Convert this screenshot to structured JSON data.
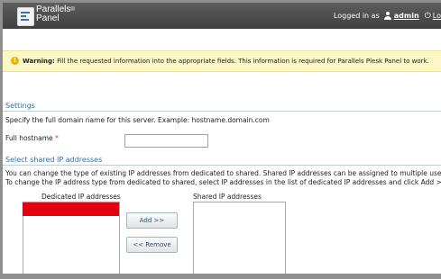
{
  "header": {
    "brand_line1": "Parallels",
    "brand_reg": "®",
    "brand_line2": "Panel",
    "logged_in_as": "Logged in as",
    "username": "admin",
    "logout_partial": "Lo"
  },
  "warning": {
    "label": "Warning:",
    "text": "Fill the requested information into the appropriate fields. This information is required for Parallels Plesk Panel to work."
  },
  "settings": {
    "title": "Settings",
    "description": "Specify the full domain name for this server. Example: hostname.domain.com",
    "hostname_label": "Full hostname",
    "required_mark": "*",
    "hostname_value": ""
  },
  "shared_ip": {
    "title": "Select shared IP addresses",
    "desc_line1": "You can change the type of existing IP addresses from dedicated to shared. Shared IP addresses can be assigned to multiple user acco",
    "desc_line2": "To change the IP address type from dedicated to shared, select IP addresses in the list of dedicated IP addresses and click Add >>.",
    "dedicated_label": "Dedicated IP addresses",
    "shared_label": "Shared IP addresses",
    "add_button": "Add >>",
    "remove_button": "<< Remove"
  },
  "colors": {
    "topbar": "#4a4a4a",
    "section_title": "#2a72b5",
    "warning_bg": "#fdf6c5",
    "redaction": "#e3000f"
  }
}
